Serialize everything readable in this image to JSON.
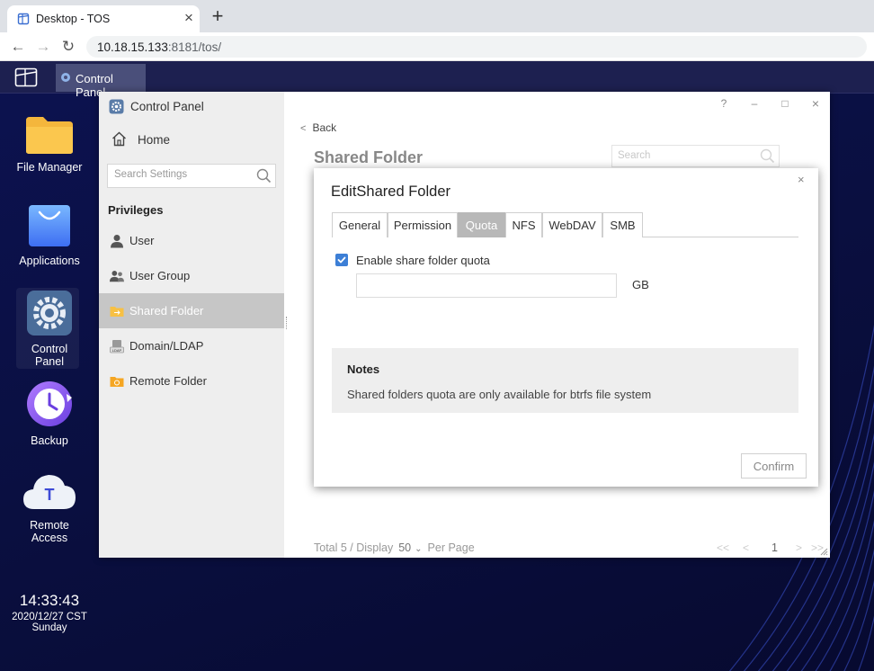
{
  "browser": {
    "tab_title": "Desktop - TOS",
    "tab_close": "×",
    "new_tab": "+",
    "url_host": "10.18.15.133",
    "url_path": ":8181/tos/"
  },
  "taskbar": {
    "app_label": "Control Panel"
  },
  "desktop": {
    "icons": [
      {
        "label": "File Manager"
      },
      {
        "label": "Applications"
      },
      {
        "label": "Control\nPanel",
        "line1": "Control",
        "line2": "Panel"
      },
      {
        "label": "Backup"
      },
      {
        "label": "Remote\nAccess",
        "line1": "Remote",
        "line2": "Access"
      }
    ],
    "clock_time": "14:33:43",
    "clock_date": "2020/12/27 CST Sunday"
  },
  "control_panel": {
    "title": "Control Panel",
    "home_label": "Home",
    "search_placeholder": "Search Settings",
    "section_privileges": "Privileges",
    "items": [
      {
        "label": "User"
      },
      {
        "label": "User Group"
      },
      {
        "label": "Shared Folder",
        "active": true
      },
      {
        "label": "Domain/LDAP"
      },
      {
        "label": "Remote Folder"
      }
    ],
    "window_controls": {
      "help": "?",
      "min": "–",
      "max": "□",
      "close": "×"
    },
    "back_label": "Back",
    "page_title": "Shared Folder",
    "page_search_placeholder": "Search",
    "pager": {
      "prefix": "Total 5 / Display",
      "per_page": "50",
      "suffix": "Per Page",
      "first": "<<",
      "prev": "<",
      "page": "1",
      "next": ">",
      "last": ">>"
    }
  },
  "modal": {
    "title": "EditShared Folder",
    "close": "×",
    "tabs": [
      {
        "label": "General"
      },
      {
        "label": "Permission"
      },
      {
        "label": "Quota",
        "active": true
      },
      {
        "label": "NFS"
      },
      {
        "label": "WebDAV"
      },
      {
        "label": "SMB"
      }
    ],
    "quota_checkbox_label": "Enable share folder quota",
    "quota_checked": true,
    "quota_value": "",
    "quota_unit": "GB",
    "notes_title": "Notes",
    "notes_text": "Shared folders quota are only available for btrfs file system",
    "confirm_label": "Confirm"
  },
  "colors": {
    "accent": "#3d7fd6",
    "active_tab": "#b8b8b8",
    "active_side_item": "#c6c6c6",
    "desktop_bg": "#0b1040"
  }
}
